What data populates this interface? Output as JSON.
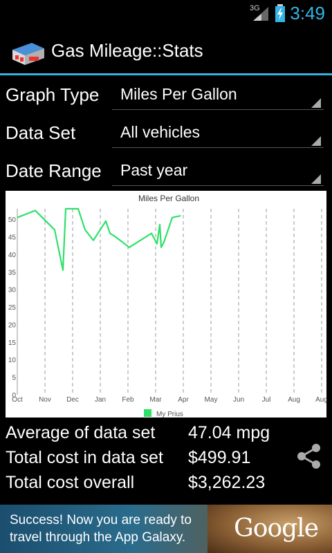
{
  "status_bar": {
    "network": "3G",
    "time": "3:49"
  },
  "action_bar": {
    "title": "Gas Mileage::Stats"
  },
  "filters": [
    {
      "label": "Graph Type",
      "value": "Miles Per Gallon"
    },
    {
      "label": "Data Set",
      "value": "All vehicles"
    },
    {
      "label": "Date Range",
      "value": "Past year"
    }
  ],
  "chart_data": {
    "type": "line",
    "title": "Miles Per Gallon",
    "categories": [
      "Oct",
      "Nov",
      "Dec",
      "Jan",
      "Feb",
      "Mar",
      "Apr",
      "May",
      "Jun",
      "Jul",
      "Aug",
      "Aug"
    ],
    "y_ticks": [
      0,
      5,
      10,
      15,
      20,
      25,
      30,
      35,
      40,
      45,
      50
    ],
    "ylim": [
      0,
      53
    ],
    "grid": "vertical-dashed",
    "legend_position": "bottom",
    "series": [
      {
        "name": "My Prius",
        "color": "#2ee06a",
        "x": [
          0,
          0.65,
          1.35,
          1.65,
          1.75,
          2.2,
          2.45,
          2.75,
          3.2,
          3.35,
          3.55,
          4.05,
          4.85,
          5.05,
          5.15,
          5.2,
          5.3,
          5.6,
          5.9
        ],
        "values": [
          50.5,
          52.5,
          47,
          35.5,
          53,
          53,
          47,
          44,
          49.5,
          46,
          45,
          42,
          46,
          43,
          48.5,
          42,
          43.5,
          50.5,
          51
        ]
      }
    ]
  },
  "stats": [
    {
      "label": "Average of data set",
      "value": "47.04 mpg"
    },
    {
      "label": "Total cost in data set",
      "value": "$499.91"
    },
    {
      "label": "Total cost overall",
      "value": "$3,262.23"
    }
  ],
  "ad": {
    "text": "Success! Now you are ready to travel through the App Galaxy.",
    "brand": "Google"
  },
  "icons": [
    "signal-icon",
    "battery-icon",
    "app-gas-station-icon",
    "spinner-arrow-icon",
    "share-icon"
  ]
}
